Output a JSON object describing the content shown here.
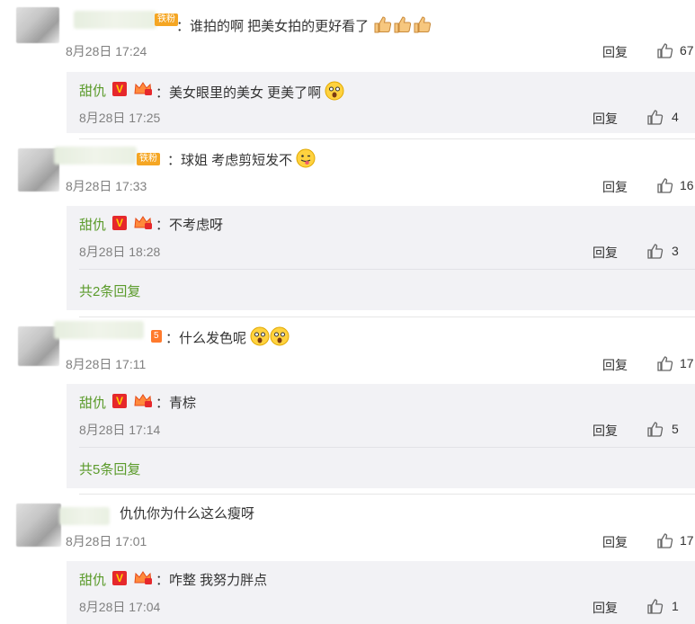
{
  "labels": {
    "reply": "回复"
  },
  "comments": [
    {
      "badge": "铁粉",
      "text": "：谁拍的啊 把美女拍的更好看了",
      "emoji": "thumbs-up-emoji ×3",
      "time": "8月28日 17:24",
      "likes": "67",
      "replies": [
        {
          "name": "甜仇",
          "text": "：美女眼里的美女 更美了啊",
          "emoji": "shocked-face-emoji",
          "time": "8月28日 17:25",
          "likes": "4"
        }
      ]
    },
    {
      "badge": "铁粉",
      "text": "：球姐 考虑剪短发不",
      "emoji": "tongue-face-emoji",
      "time": "8月28日 17:33",
      "likes": "16",
      "replies": [
        {
          "name": "甜仇",
          "text": "：不考虑呀",
          "time": "8月28日 18:28",
          "likes": "3"
        }
      ],
      "more": "共2条回复"
    },
    {
      "badge": "5",
      "text": "：什么发色呢",
      "emoji": "shocked-face-emoji ×2",
      "time": "8月28日 17:11",
      "likes": "17",
      "replies": [
        {
          "name": "甜仇",
          "text": "：青棕",
          "time": "8月28日 17:14",
          "likes": "5"
        }
      ],
      "more": "共5条回复"
    },
    {
      "text": "仇仇你为什么这么瘦呀",
      "time": "8月28日 17:01",
      "likes": "17",
      "replies": [
        {
          "name": "甜仇",
          "text": "：咋整 我努力胖点",
          "time": "8月28日 17:04",
          "likes": "1"
        }
      ]
    }
  ]
}
